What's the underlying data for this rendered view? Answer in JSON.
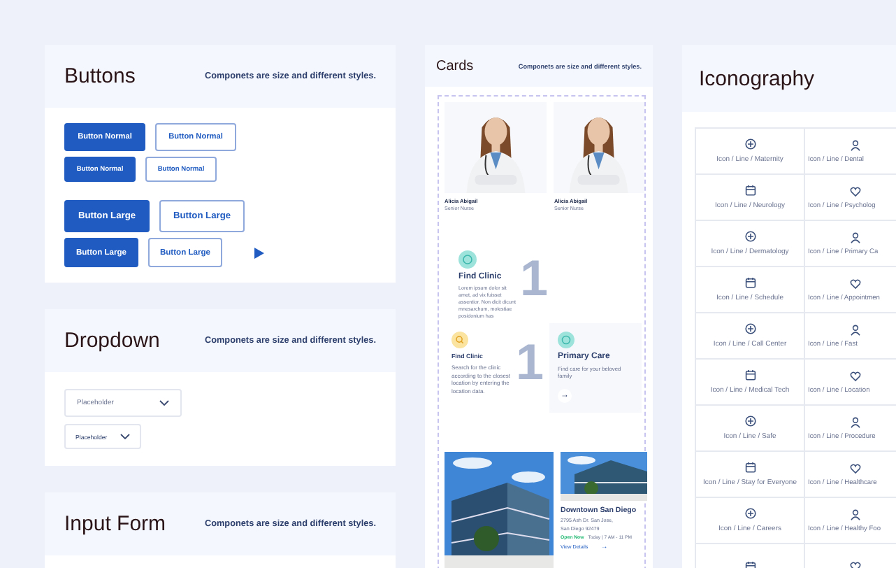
{
  "buttons_panel": {
    "title": "Buttons",
    "subtitle": "Componets are size and different styles.",
    "rows": [
      {
        "kind": "normal",
        "buttons": [
          {
            "label": "Button Normal",
            "kind": "filled"
          },
          {
            "label": "Button Normal",
            "kind": "outline"
          }
        ]
      },
      {
        "kind": "small",
        "buttons": [
          {
            "label": "Button Normal",
            "kind": "filled"
          },
          {
            "label": "Button Normal",
            "kind": "outline"
          }
        ]
      },
      {
        "kind": "large",
        "buttons": [
          {
            "label": "Button Large",
            "kind": "filled"
          },
          {
            "label": "Button Large",
            "kind": "outline"
          }
        ]
      },
      {
        "kind": "medium",
        "buttons": [
          {
            "label": "Button Large",
            "kind": "filled"
          },
          {
            "label": "Button Large",
            "kind": "outline"
          }
        ]
      }
    ]
  },
  "dropdown_panel": {
    "title": "Dropdown",
    "subtitle": "Componets are size and different styles.",
    "dropdowns": [
      {
        "placeholder": "Placeholder",
        "kind": "large"
      },
      {
        "placeholder": "Placeholder",
        "kind": "small"
      }
    ]
  },
  "input_form_panel": {
    "title": "Input Form",
    "subtitle": "Componets are size and different styles."
  },
  "cards_panel": {
    "title": "Cards",
    "subtitle": "Componets are size and different styles.",
    "profiles": [
      {
        "name": "Alicia Abigail",
        "role": "Senior Nurse"
      },
      {
        "name": "Alicia Abigail",
        "role": "Senior Nurse"
      }
    ],
    "feature_card": {
      "title": "Find Clinic",
      "text": "Lorem ipsum dolor sit amet, ad vix fuisset assentior. Non dicit dicunt mnesarchum, molestiae posidonium has",
      "number": "1",
      "color": "#9de3dc"
    },
    "small_cards": [
      {
        "title": "Find Clinic",
        "text": "Search for the clinic according to the closest location by entering the location data.",
        "number": "1",
        "color": "#fbe3a0"
      },
      {
        "title": "Primary Care",
        "text": "Find care for your beloved family",
        "arrow": "→",
        "color": "#9de3dc"
      }
    ],
    "location": {
      "title": "Downtown San Diego",
      "address": [
        "2795 Ash Dr. San Jose,",
        "San Diego 92479"
      ],
      "status": "Open Now",
      "hours": "Today | 7 AM - 11 PM",
      "link": "View Details",
      "arrow": "→"
    }
  },
  "iconography_panel": {
    "title": "Iconography",
    "rows": [
      [
        {
          "label": "Icon / Line / Maternity"
        },
        {
          "label": "Icon / Line / Dental"
        }
      ],
      [
        {
          "label": "Icon / Line / Neurology"
        },
        {
          "label": "Icon / Line / Psycholog"
        }
      ],
      [
        {
          "label": "Icon / Line / Dermatology"
        },
        {
          "label": "Icon / Line / Primary Ca"
        }
      ],
      [
        {
          "label": "Icon / Line / Schedule"
        },
        {
          "label": "Icon / Line / Appointmen"
        }
      ],
      [
        {
          "label": "Icon / Line / Call Center"
        },
        {
          "label": "Icon / Line / Fast"
        }
      ],
      [
        {
          "label": "Icon / Line / Medical Tech"
        },
        {
          "label": "Icon / Line / Location"
        }
      ],
      [
        {
          "label": "Icon / Line / Safe"
        },
        {
          "label": "Icon / Line / Procedure"
        }
      ],
      [
        {
          "label": "Icon / Line / Stay for Everyone"
        },
        {
          "label": "Icon / Line / Healthcare"
        }
      ],
      [
        {
          "label": "Icon / Line / Careers"
        },
        {
          "label": "Icon / Line / Healthy Foo"
        }
      ],
      [
        {},
        {}
      ]
    ]
  }
}
